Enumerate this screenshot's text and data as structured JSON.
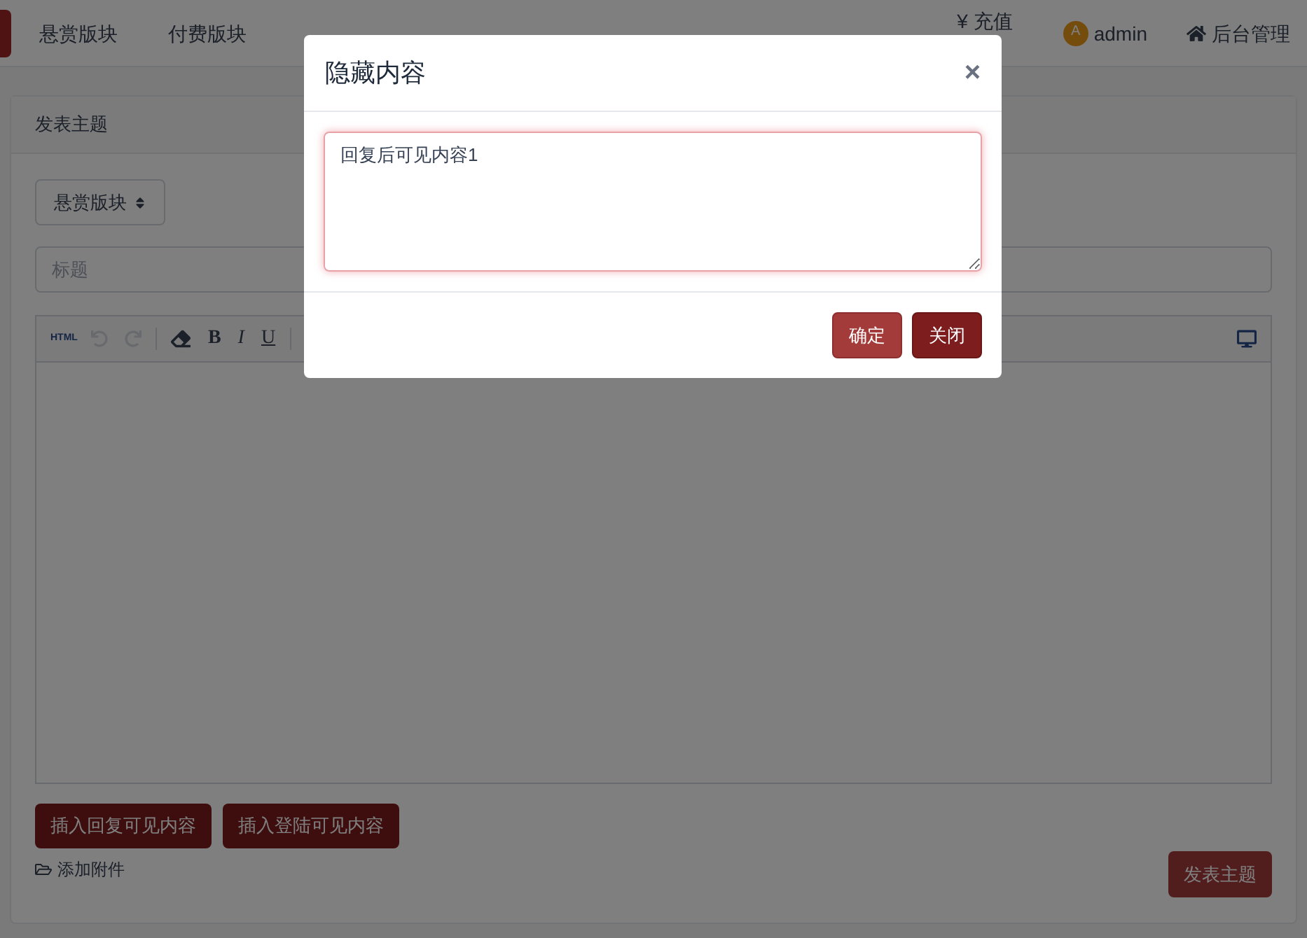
{
  "navbar": {
    "items": [
      {
        "label": "悬赏版块"
      },
      {
        "label": "付费版块"
      }
    ],
    "right": {
      "recharge": "¥ 充值",
      "avatar_letter": "A",
      "user": "admin",
      "admin": "后台管理"
    }
  },
  "card": {
    "title": "发表主题",
    "board_select": "悬赏版块",
    "title_field": {
      "placeholder": "标题"
    },
    "toolbar": [
      {
        "kind": "html",
        "label": "HTML",
        "disabled": false
      },
      {
        "kind": "undo",
        "disabled": true
      },
      {
        "kind": "redo",
        "disabled": true
      },
      {
        "kind": "sep"
      },
      {
        "kind": "eraser",
        "disabled": false
      },
      {
        "kind": "bold",
        "label": "B",
        "disabled": false
      },
      {
        "kind": "italic",
        "label": "I",
        "disabled": false
      },
      {
        "kind": "underline",
        "label": "U",
        "disabled": false
      },
      {
        "kind": "sep"
      }
    ],
    "insert_buttons": [
      "插入回复可见内容",
      "插入登陆可见内容"
    ],
    "attach": "添加附件",
    "submit": "发表主题"
  },
  "modal": {
    "title": "隐藏内容",
    "close": "×",
    "textarea": {
      "value": "回复后可见内容1"
    },
    "buttons": [
      {
        "label": "确定",
        "kind": "primary"
      },
      {
        "label": "关闭",
        "kind": "dark"
      }
    ]
  }
}
